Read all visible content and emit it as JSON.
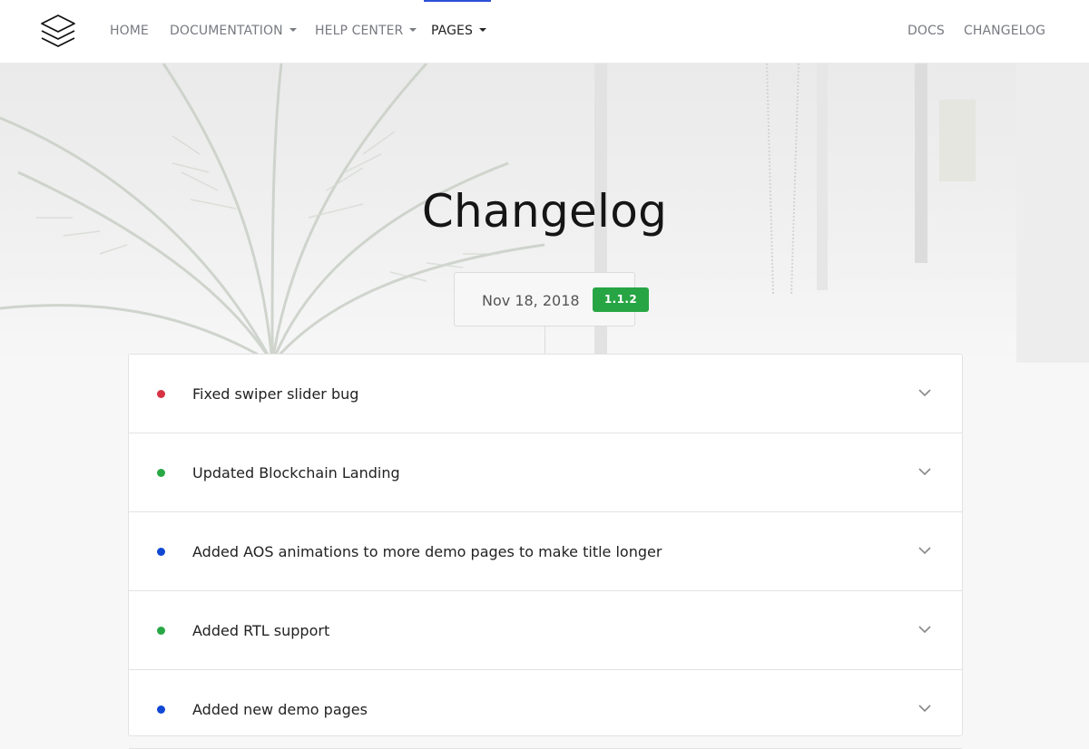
{
  "nav": {
    "brand_icon": "layers-icon",
    "items": [
      {
        "label": "HOME",
        "dropdown": false,
        "active": false
      },
      {
        "label": "DOCUMENTATION",
        "dropdown": true,
        "active": false
      },
      {
        "label": "HELP CENTER",
        "dropdown": true,
        "active": false
      },
      {
        "label": "PAGES",
        "dropdown": true,
        "active": true
      }
    ],
    "right_items": [
      {
        "label": "DOCS"
      },
      {
        "label": "CHANGELOG"
      }
    ]
  },
  "hero": {
    "title": "Changelog"
  },
  "release": {
    "date": "Nov 18, 2018",
    "version": "1.1.2",
    "version_color": "#27a544"
  },
  "entries": [
    {
      "title": "Fixed swiper slider bug",
      "status_color": "#d63243",
      "icon": "chevron-down-icon"
    },
    {
      "title": "Updated Blockchain Landing",
      "status_color": "#28a745",
      "icon": "chevron-down-icon"
    },
    {
      "title": "Added AOS animations to more demo pages to make title longer",
      "status_color": "#1048d4",
      "icon": "chevron-down-icon"
    },
    {
      "title": "Added RTL support",
      "status_color": "#28a745",
      "icon": "chevron-down-icon"
    },
    {
      "title": "Added new demo pages",
      "status_color": "#1048d4",
      "icon": "chevron-down-icon"
    }
  ]
}
